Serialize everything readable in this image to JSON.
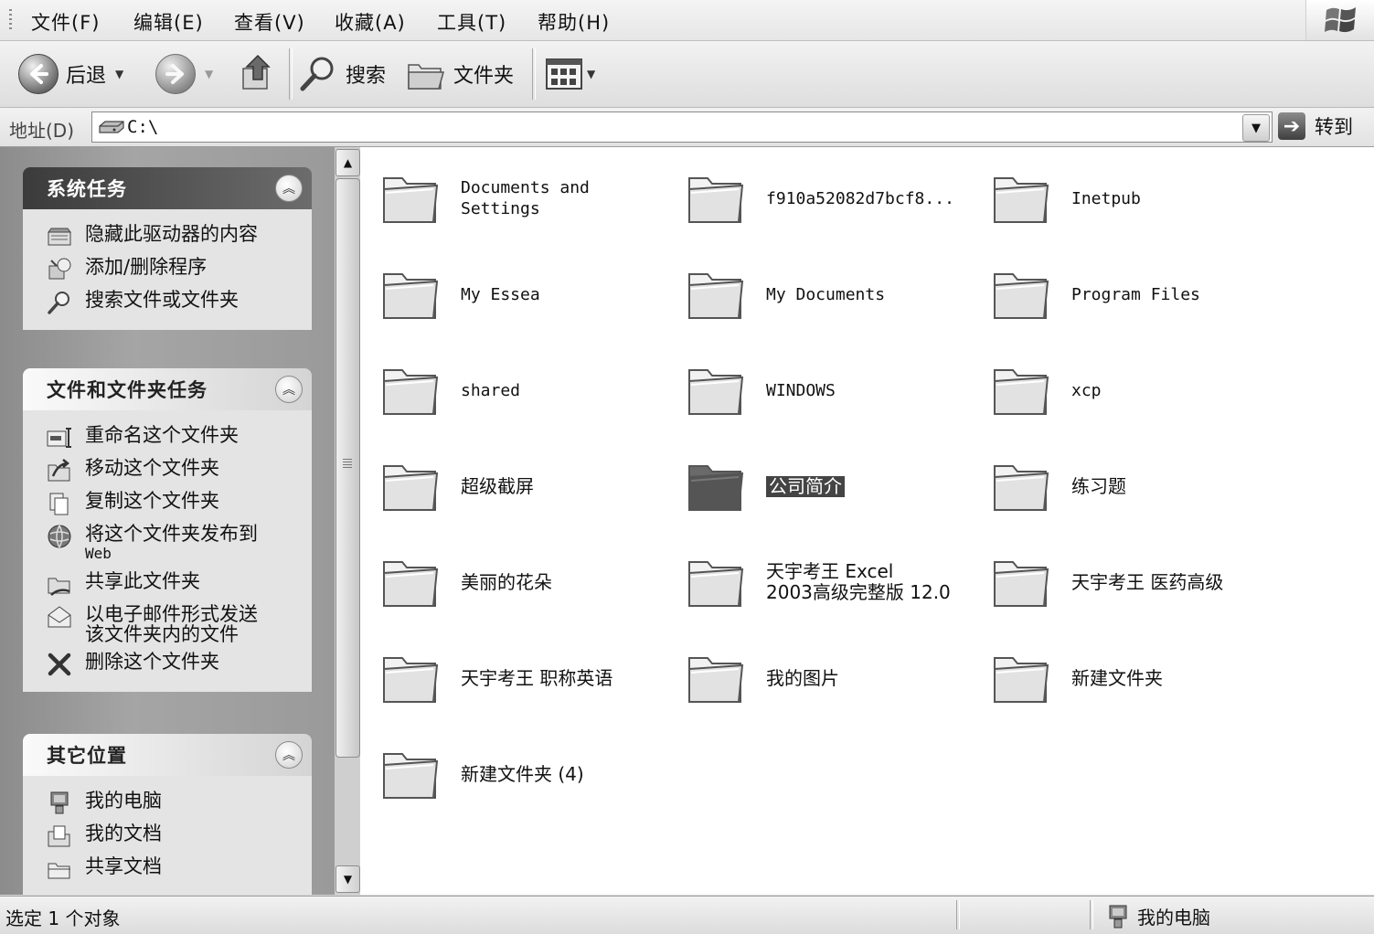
{
  "menubar": {
    "items": [
      "文件(F)",
      "编辑(E)",
      "查看(V)",
      "收藏(A)",
      "工具(T)",
      "帮助(H)"
    ]
  },
  "toolbar": {
    "back_label": "后退",
    "search_label": "搜索",
    "folders_label": "文件夹"
  },
  "address": {
    "label": "地址(D)",
    "value": "C:\\",
    "go_label": "转到"
  },
  "taskpane": {
    "system_tasks": {
      "title": "系统任务",
      "items": [
        {
          "label": "隐藏此驱动器的内容",
          "icon": "drive-hide-icon"
        },
        {
          "label": "添加/删除程序",
          "icon": "add-remove-programs-icon"
        },
        {
          "label": "搜索文件或文件夹",
          "icon": "search-icon"
        }
      ]
    },
    "file_tasks": {
      "title": "文件和文件夹任务",
      "items": [
        {
          "label": "重命名这个文件夹",
          "icon": "rename-icon"
        },
        {
          "label": "移动这个文件夹",
          "icon": "move-icon"
        },
        {
          "label": "复制这个文件夹",
          "icon": "copy-icon"
        },
        {
          "label": "将这个文件夹发布到",
          "sub": "Web",
          "icon": "publish-web-icon"
        },
        {
          "label": "共享此文件夹",
          "icon": "share-icon"
        },
        {
          "label": "以电子邮件形式发送\n该文件夹内的文件",
          "icon": "email-icon"
        },
        {
          "label": "删除这个文件夹",
          "icon": "delete-icon"
        }
      ]
    },
    "other_places": {
      "title": "其它位置",
      "items": [
        {
          "label": "我的电脑",
          "icon": "my-computer-icon"
        },
        {
          "label": "我的文档",
          "icon": "my-documents-icon"
        },
        {
          "label": "共享文档",
          "icon": "shared-documents-icon"
        }
      ]
    }
  },
  "folders": [
    {
      "name": "Documents and\nSettings",
      "mono": true
    },
    {
      "name": "f910a52082d7bcf8...",
      "mono": true
    },
    {
      "name": "Inetpub",
      "mono": true
    },
    {
      "name": "My  Essea",
      "mono": true
    },
    {
      "name": "My Documents",
      "mono": true
    },
    {
      "name": "Program Files",
      "mono": true
    },
    {
      "name": "shared",
      "mono": true
    },
    {
      "name": "WINDOWS",
      "mono": true
    },
    {
      "name": "xcp",
      "mono": true
    },
    {
      "name": "超级截屏",
      "mono": false
    },
    {
      "name": "公司简介",
      "mono": false,
      "selected": true
    },
    {
      "name": "练习题",
      "mono": false
    },
    {
      "name": "美丽的花朵",
      "mono": false
    },
    {
      "name": "天宇考王  Excel\n2003高级完整版 12.0",
      "mono": false
    },
    {
      "name": "天宇考王 医药高级",
      "mono": false
    },
    {
      "name": "天宇考王 职称英语",
      "mono": false
    },
    {
      "name": "我的图片",
      "mono": false
    },
    {
      "name": "新建文件夹",
      "mono": false
    },
    {
      "name": "新建文件夹 (4)",
      "mono": false
    }
  ],
  "statusbar": {
    "left": "选定 1 个对象",
    "right": "我的电脑"
  }
}
